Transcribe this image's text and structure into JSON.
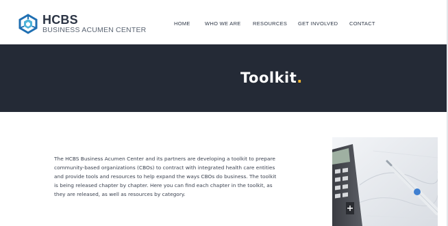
{
  "brand": {
    "title": "HCBS",
    "subtitle": "BUSINESS ACUMEN CENTER",
    "colors": {
      "primary": "#1f6fb2",
      "accent": "#4fb3d9",
      "dark": "#2b3444"
    }
  },
  "nav": {
    "items": [
      {
        "label": "HOME"
      },
      {
        "label": "WHO WE ARE"
      },
      {
        "label": "RESOURCES"
      },
      {
        "label": "GET INVOLVED"
      },
      {
        "label": "CONTACT"
      }
    ]
  },
  "hero": {
    "title": "Toolkit",
    "dot": ".",
    "background": "#242a36",
    "dot_color": "#f2b632"
  },
  "content": {
    "intro": "The HCBS Business Acumen Center and its partners are developing a toolkit to prepare community-based organizations (CBOs) to contract with integrated health care entities and provide tools and resources to help expand the ways CBOs do business. The toolkit is being released chapter by chapter. Here you can find each chapter in the toolkit, as they are released, as well as resources by category."
  },
  "image": {
    "icon": "calculator-photo"
  }
}
